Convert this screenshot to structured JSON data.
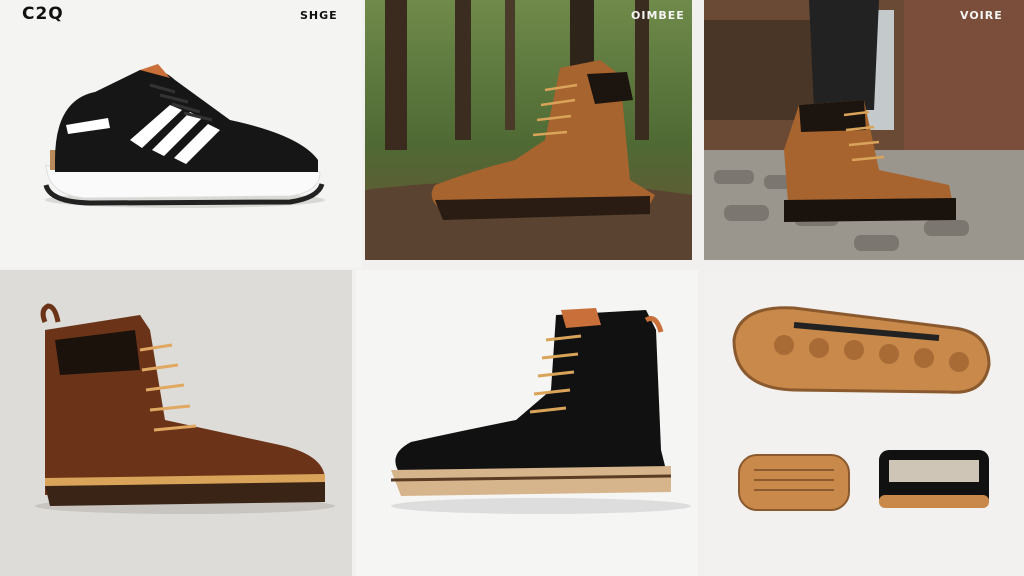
{
  "brand_mark": "C2Q",
  "tags": {
    "tile1": "SHGE",
    "tile2": "OIMBEE",
    "tile3": "VOIRE"
  },
  "colors": {
    "background": "#f1f0ee",
    "tan_leather": "#a8642e",
    "dark_brown_leather": "#6b3419",
    "black_leather": "#111111",
    "gum_sole": "#c8894b",
    "forest_green": "#3f5a2a",
    "cobblestone": "#9a958d"
  },
  "tiles": [
    {
      "subject": "sneaker-black-white-stripes",
      "background": "studio"
    },
    {
      "subject": "tan-leather-boot",
      "background": "forest"
    },
    {
      "subject": "tan-leather-boot-worn",
      "background": "cobblestone-street"
    },
    {
      "subject": "brown-leather-boot",
      "background": "studio"
    },
    {
      "subject": "black-leather-boot",
      "background": "studio"
    },
    {
      "subject": "gum-sole-and-care-accessories",
      "background": "studio"
    }
  ]
}
